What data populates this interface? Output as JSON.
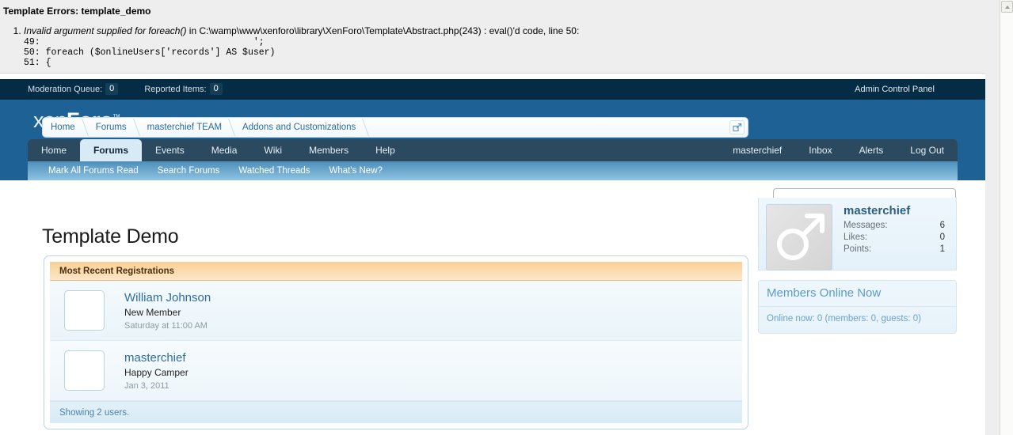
{
  "error": {
    "title": "Template Errors: template_demo",
    "items": [
      {
        "message": "Invalid argument supplied for foreach()",
        "location": " in C:\\wamp\\www\\xenforo\\library\\XenForo\\Template\\Abstract.php(243) : eval()'d code, line 50:",
        "code": "49:                                       ';\n50: foreach ($onlineUsers['records'] AS $user)\n51: {"
      }
    ]
  },
  "topbar": {
    "moderation_queue_label": "Moderation Queue:",
    "moderation_queue_count": "0",
    "reported_items_label": "Reported Items:",
    "reported_items_count": "0",
    "admin_cp": "Admin Control Panel"
  },
  "logo": {
    "part1": "xen",
    "part2": "Foro",
    "tm": "™"
  },
  "nav": {
    "tabs": [
      {
        "label": "Home",
        "selected": false
      },
      {
        "label": "Forums",
        "selected": true
      },
      {
        "label": "Events",
        "selected": false
      },
      {
        "label": "Media",
        "selected": false
      },
      {
        "label": "Wiki",
        "selected": false
      },
      {
        "label": "Members",
        "selected": false
      },
      {
        "label": "Help",
        "selected": false
      }
    ],
    "account": [
      {
        "label": "masterchief"
      },
      {
        "label": "Inbox"
      },
      {
        "label": "Alerts"
      },
      {
        "label": "Log Out"
      }
    ],
    "subnav": [
      {
        "label": "Mark All Forums Read"
      },
      {
        "label": "Search Forums"
      },
      {
        "label": "Watched Threads"
      },
      {
        "label": "What's New?"
      }
    ]
  },
  "search": {
    "value": "",
    "placeholder": ""
  },
  "breadcrumb": {
    "items": [
      {
        "label": "Home"
      },
      {
        "label": "Forums"
      },
      {
        "label": "masterchief TEAM"
      },
      {
        "label": "Addons and Customizations"
      }
    ],
    "jump_icon": "open-in-new-window-icon"
  },
  "page": {
    "title": "Template Demo"
  },
  "panel": {
    "heading": "Most Recent Registrations",
    "footer": "Showing 2 users.",
    "registrations": [
      {
        "name": "William Johnson",
        "user_title": "New Member",
        "date": "Saturday at 11:00 AM",
        "avatar": "empty-avatar"
      },
      {
        "name": "masterchief",
        "user_title": "Happy Camper",
        "date": "Jan 3, 2011",
        "avatar": "empty-avatar"
      }
    ]
  },
  "sidebar": {
    "visitor": {
      "name": "masterchief",
      "avatar_icon": "male-gender-symbol-icon",
      "stats": [
        {
          "label": "Messages:",
          "value": "6"
        },
        {
          "label": "Likes:",
          "value": "0"
        },
        {
          "label": "Points:",
          "value": "1"
        }
      ]
    },
    "online": {
      "heading": "Members Online Now",
      "text": "Online now: 0 (members: 0, guests: 0)"
    }
  },
  "scrollbar": {
    "up_arrow": "scroll-up-arrow-icon"
  },
  "colors": {
    "header_blue": "#1D6195",
    "topbar_dark": "#052C45",
    "nav_bar": "#2B4A60",
    "tab_selected": "#D7EAF5",
    "panel_heading_orange": "#F9CF93",
    "link_blue": "#2F6D9E"
  }
}
